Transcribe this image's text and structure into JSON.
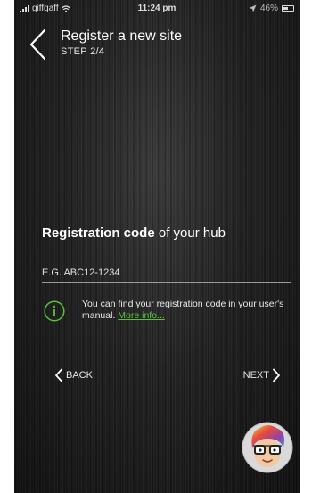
{
  "status_bar": {
    "carrier": "giffgaff",
    "time": "11:24 pm",
    "battery_percent": "46%",
    "signal_icon": "signal-bars-icon",
    "wifi_icon": "wifi-icon",
    "battery_icon": "battery-icon"
  },
  "header": {
    "title": "Register a new site",
    "step": "STEP 2/4",
    "back_icon": "chevron-left-icon"
  },
  "registration": {
    "heading_bold": "Registration code",
    "heading_rest": " of your hub",
    "placeholder": "E.G. ABC12-1234",
    "value": "",
    "info_icon": "info-circle-icon",
    "info_text": "You can find your registration code in your user's manual. ",
    "more_info_link": "More info..."
  },
  "nav": {
    "back_label": "BACK",
    "next_label": "NEXT"
  },
  "colors": {
    "accent_green": "#58c23c",
    "text": "#ffffff",
    "background": "#1c1c1c"
  }
}
